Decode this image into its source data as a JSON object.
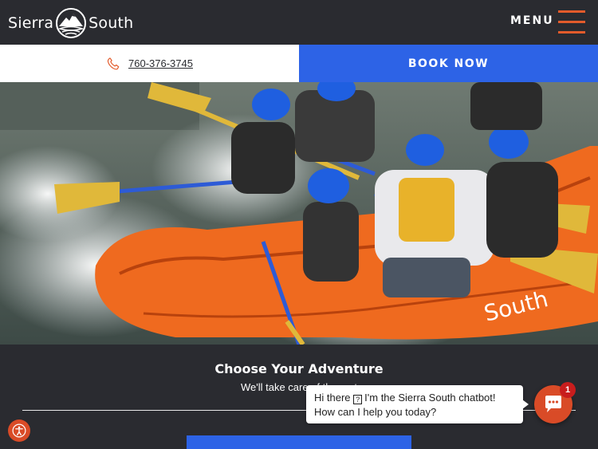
{
  "header": {
    "brand_left": "Sierra",
    "brand_right": "South",
    "logo_icon": "mountain-kayak-logo",
    "menu_label": "MENU",
    "menu_icon": "hamburger-icon",
    "accent_color": "#e35b2b",
    "background_color": "#2a2b30"
  },
  "contact_bar": {
    "phone_icon": "phone-icon",
    "phone_number": "760-376-3745",
    "book_label": "BOOK NOW",
    "book_color": "#2d63e6"
  },
  "hero": {
    "image": "whitewater-rafting-photo",
    "raft_brand": "South"
  },
  "section": {
    "title": "Choose Your Adventure",
    "subtitle": "We'll take care of the rest"
  },
  "chat": {
    "greeting_prefix": "Hi there",
    "greeting_text": "I'm the Sierra South chatbot!",
    "greeting_line2": "How can I help you today?",
    "unread_count": "1",
    "launcher_icon": "chat-icon",
    "launcher_color": "#d94b27"
  },
  "accessibility": {
    "icon": "accessibility-icon"
  }
}
